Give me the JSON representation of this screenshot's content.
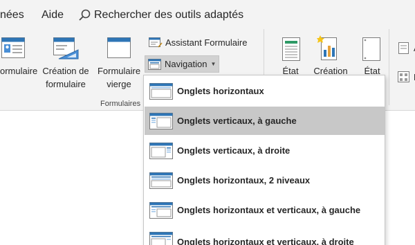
{
  "menu": {
    "tab_data": "nées",
    "tab_help": "Aide",
    "search_label": "Rechercher des outils adaptés"
  },
  "ribbon": {
    "formulaire_label_1": "ormulaire",
    "creation_label_1": "Création de",
    "creation_label_2": "formulaire",
    "vierge_label_1": "Formulaire",
    "vierge_label_2": "vierge",
    "assistant_label": "Assistant Formulaire",
    "navigation_label": "Navigation",
    "group_label": "Formulaires",
    "etat_label": "État",
    "creation_etat_label": "Création",
    "etat_vierge_label": "État",
    "partial_label_a": "A",
    "partial_label_e": "É"
  },
  "dropdown": {
    "items": [
      {
        "label": "Onglets horizontaux",
        "accel": "h"
      },
      {
        "label": "Onglets verticaux, à gauche"
      },
      {
        "label": "Onglets verticaux, à droite"
      },
      {
        "label": "Onglets horizontaux, 2 niveaux"
      },
      {
        "label": "Onglets horizontaux et verticaux, à gauche"
      },
      {
        "label": "Onglets horizontaux et verticaux, à droite"
      }
    ],
    "active_index": 1
  },
  "colors": {
    "ribbon_bg": "#f3f3f3",
    "nav_button_bg": "#d2d2d2",
    "active_item_bg": "#c8c8c8",
    "form_header_blue": "#2e75b6",
    "access_red": "#a4373a"
  }
}
